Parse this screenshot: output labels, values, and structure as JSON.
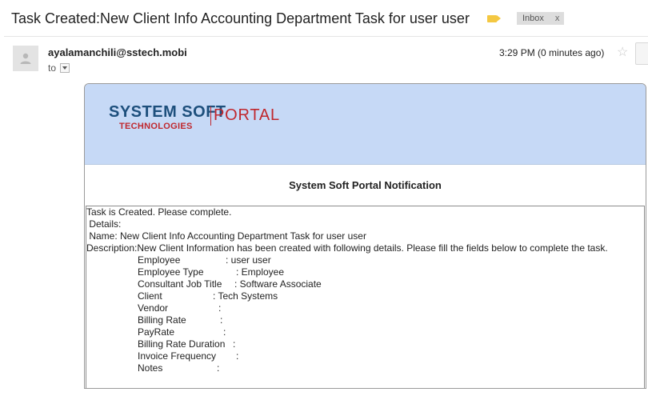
{
  "header": {
    "subject": "Task Created:New Client Info Accounting Department Task for user user",
    "label_chip": "Inbox",
    "label_chip_close": "x"
  },
  "message": {
    "sender": "ayalamanchili@sstech.mobi",
    "to_label": "to",
    "time": "3:29 PM (0 minutes ago)"
  },
  "email": {
    "logo_main": "SYSTEM SOFT",
    "logo_sub": "TECHNOLOGIES",
    "logo_portal": "PORTAL",
    "notification_title": "System Soft Portal Notification",
    "intro": "Task is Created. Please complete.",
    "details": " Details:",
    "name": " Name: New Client Info Accounting Department Task for user user",
    "description": " Description:New Client Information has been created with following details. Please fill the fields below to complete the task.",
    "fields": [
      {
        "label": "Employee",
        "value": ": user user"
      },
      {
        "label": "Employee Type",
        "value": ": Employee"
      },
      {
        "label": "Consultant Job Title",
        "value": ": Software Associate"
      },
      {
        "label": "Client",
        "value": ": Tech Systems"
      },
      {
        "label": "Vendor",
        "value": ":"
      },
      {
        "label": "Billing Rate",
        "value": ":"
      },
      {
        "label": "PayRate",
        "value": ":"
      },
      {
        "label": "Billing Rate Duration",
        "value": ":"
      },
      {
        "label": "Invoice Frequency",
        "value": ":"
      },
      {
        "label": "Notes",
        "value": ":"
      }
    ]
  },
  "colors": {
    "banner": "#c6d9f6",
    "logo_blue": "#1d4f7c",
    "logo_red": "#c0272d",
    "label_yellow": "#f4c842"
  },
  "icons": {
    "label": "label-tag-icon",
    "avatar": "person-avatar-icon",
    "dropdown": "chevron-down-icon",
    "star": "star-icon"
  }
}
